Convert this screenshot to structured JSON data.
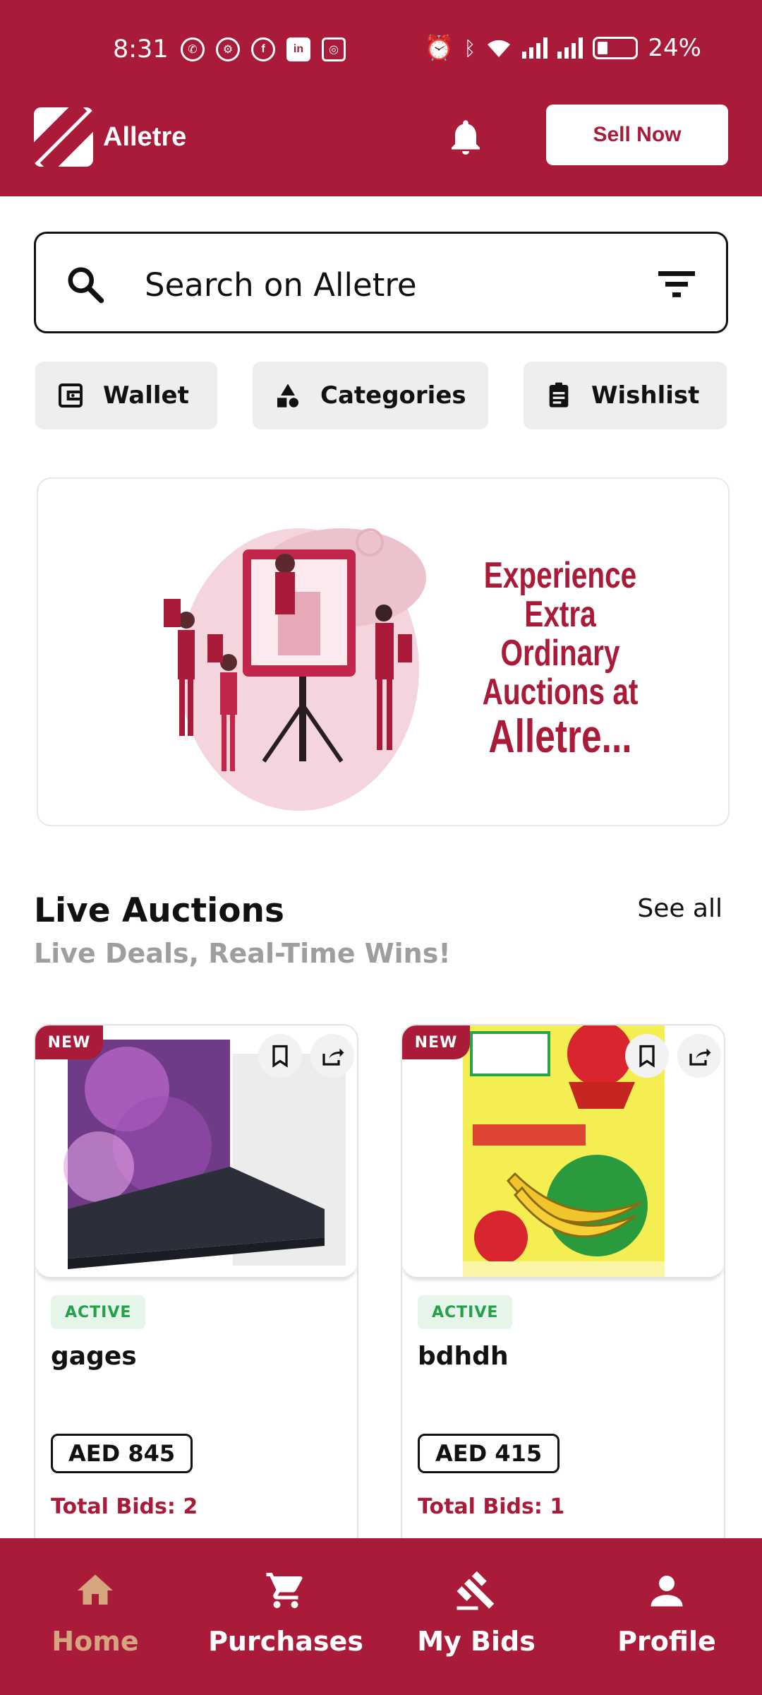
{
  "status_bar": {
    "time": "8:31",
    "battery": "24%",
    "notification_icons": [
      "whatsapp-icon",
      "settings-icon",
      "facebook-icon",
      "linkedin-icon",
      "instagram-icon"
    ],
    "system_icons": [
      "alarm-icon",
      "bluetooth-icon",
      "wifi-icon",
      "signal-icon",
      "signal-roaming-icon",
      "battery-icon"
    ]
  },
  "header": {
    "app_name": "Alletre",
    "sell_label": "Sell Now",
    "icons": [
      "logo-icon",
      "bell-icon"
    ]
  },
  "search": {
    "placeholder": "Search on Alletre",
    "icons": [
      "search-icon",
      "filter-icon"
    ]
  },
  "quick_actions": [
    {
      "label": "Wallet",
      "icon": "wallet-icon"
    },
    {
      "label": "Categories",
      "icon": "categories-icon"
    },
    {
      "label": "Wishlist",
      "icon": "clipboard-icon"
    }
  ],
  "banner": {
    "lines": [
      "Experience",
      "Extra Ordinary",
      "Auctions at",
      "Alletre..."
    ]
  },
  "live_auctions": {
    "title": "Live Auctions",
    "subtitle": "Live Deals, Real-Time Wins!",
    "see_all": "See all",
    "items": [
      {
        "badge": "NEW",
        "status": "ACTIVE",
        "title": "gages",
        "price": "AED 845",
        "bids": "Total Bids: 2",
        "image": "laptop"
      },
      {
        "badge": "NEW",
        "status": "ACTIVE",
        "title": "bdhdh",
        "price": "AED 415",
        "bids": "Total Bids: 1",
        "image": "banana-sale-flyer"
      }
    ]
  },
  "bottom_nav": [
    {
      "label": "Home",
      "icon": "home-icon",
      "active": true
    },
    {
      "label": "Purchases",
      "icon": "cart-icon",
      "active": false
    },
    {
      "label": "My Bids",
      "icon": "gavel-icon",
      "active": false
    },
    {
      "label": "Profile",
      "icon": "person-icon",
      "active": false
    }
  ],
  "colors": {
    "brand": "#a91b39",
    "active_nav": "#d4a57f",
    "status_active": "#22a04a",
    "status_active_bg": "#e6f5ea"
  }
}
